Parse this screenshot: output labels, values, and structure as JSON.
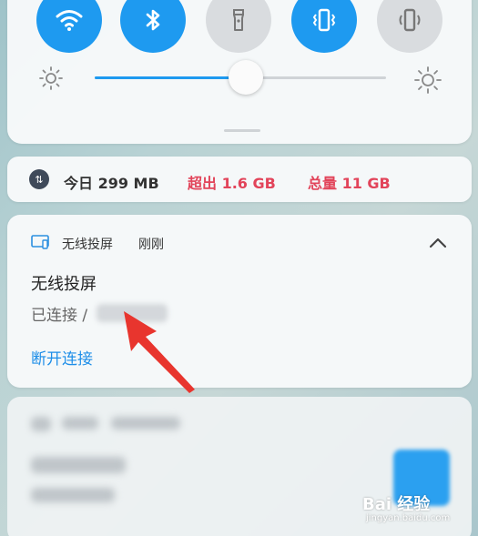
{
  "quick_settings": {
    "toggles": [
      {
        "icon": "wifi-icon",
        "state": "on"
      },
      {
        "icon": "bluetooth-icon",
        "state": "on"
      },
      {
        "icon": "flashlight-icon",
        "state": "off"
      },
      {
        "icon": "vibrate-icon",
        "state": "on"
      },
      {
        "icon": "sound-mode-icon",
        "state": "off"
      }
    ],
    "brightness_level": 0.52,
    "accent_color": "#1e9af0"
  },
  "data_usage": {
    "today": "今日 299 MB",
    "over": "超出 1.6 GB",
    "total": "总量 11 GB",
    "warning_color": "#e2445a"
  },
  "notification": {
    "app_name": "无线投屏",
    "time": "刚刚",
    "title": "无线投屏",
    "status": "已连接 /",
    "action": "断开连接"
  },
  "watermark": {
    "brand": "Bai 经验",
    "url": "jingyan.baidu.com"
  }
}
